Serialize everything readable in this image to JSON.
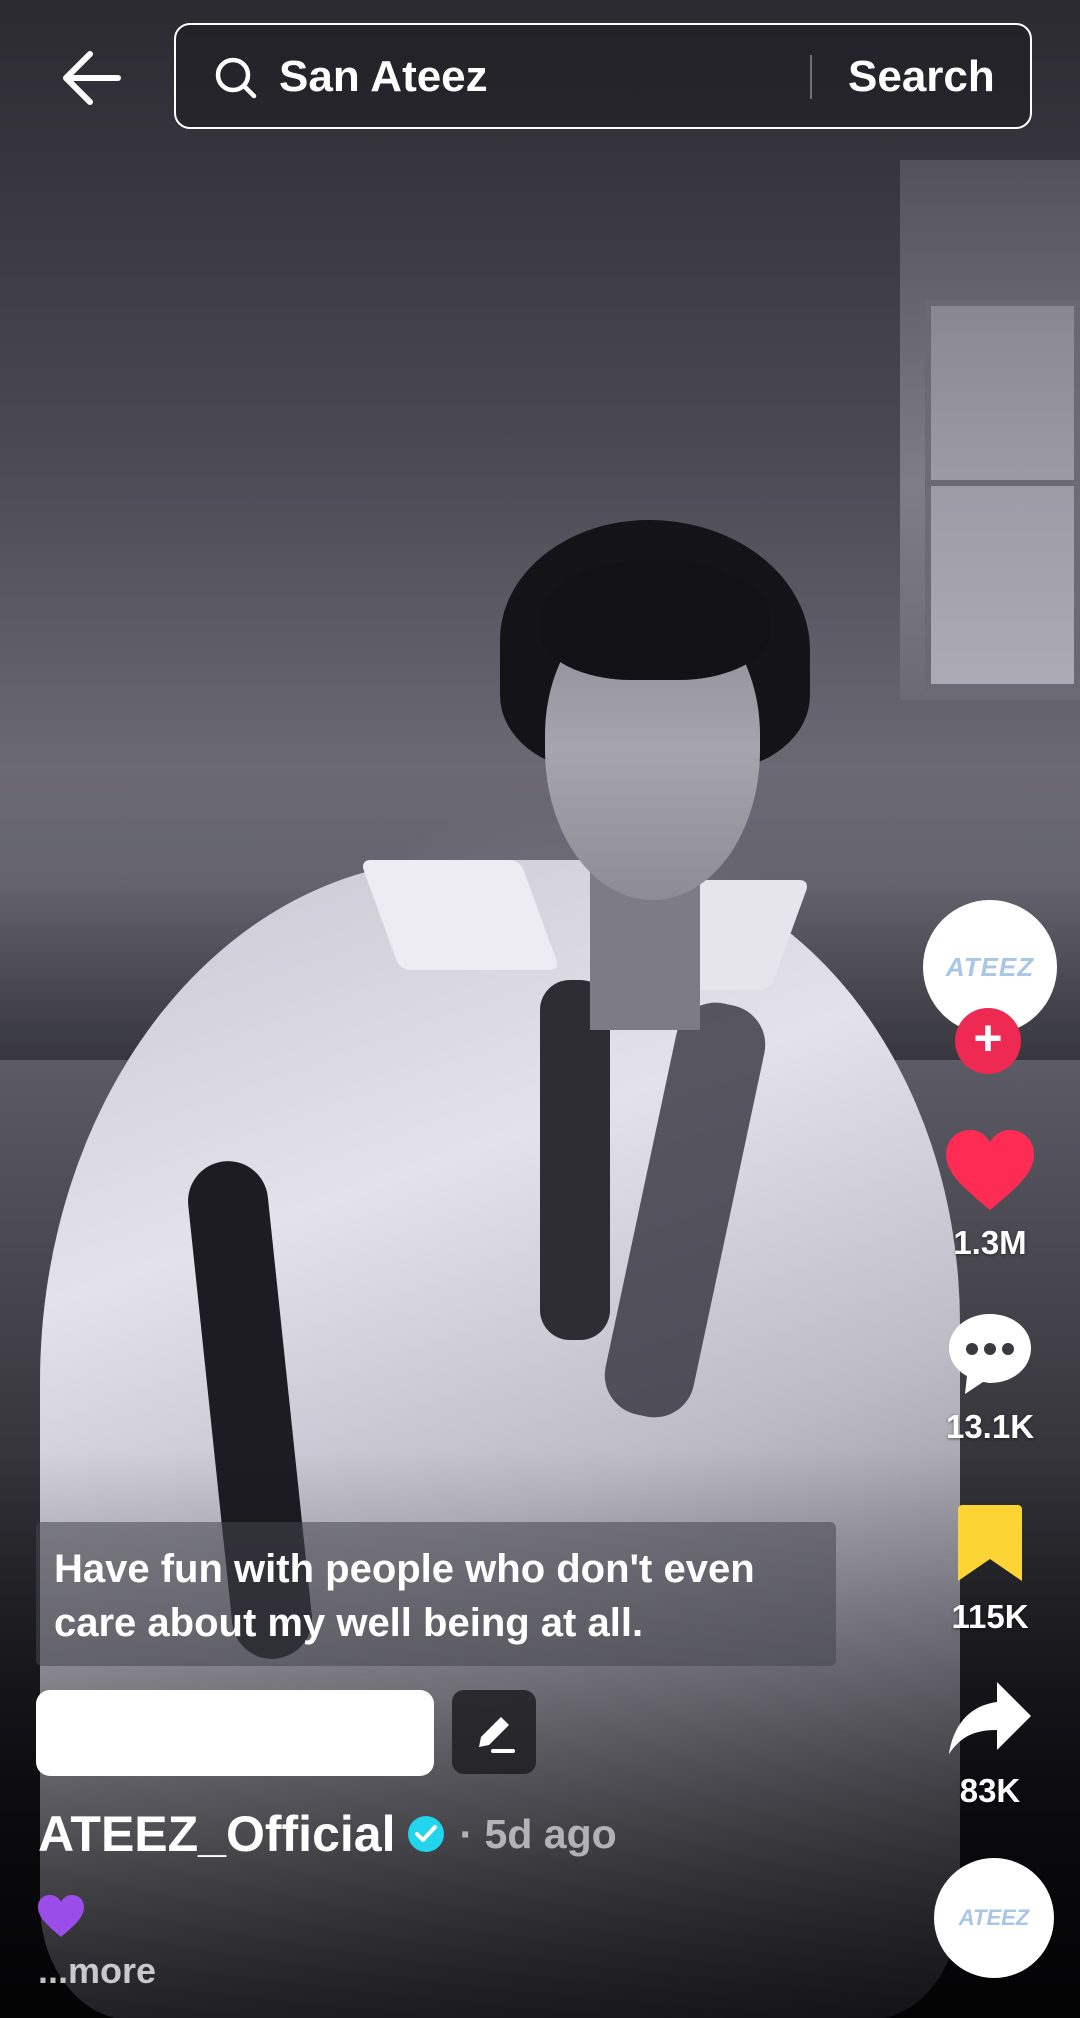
{
  "search": {
    "query": "San Ateez",
    "button_label": "Search"
  },
  "creator": {
    "avatar_logo": "ATEEZ",
    "follow_symbol": "+",
    "name": "ATEEZ_Official",
    "verified": true,
    "posted": "· 5d ago"
  },
  "actions": {
    "likes": "1.3M",
    "comments": "13.1K",
    "saves": "115K",
    "shares": "83K"
  },
  "video": {
    "overlay_text": "Have fun with people who don't even care about my well being at all."
  },
  "caption": {
    "emoji": "purple-heart",
    "more_label": "...more"
  },
  "sound": {
    "disc_logo": "ATEEZ"
  },
  "colors": {
    "like": "#fe2c55",
    "follow": "#ee2a52",
    "save": "#fcd535",
    "verified": "#20d5ec",
    "caption_heart": "#9b4dea"
  },
  "icons": [
    "back-arrow-icon",
    "search-icon",
    "heart-icon",
    "comment-icon",
    "bookmark-icon",
    "share-icon",
    "edit-pencil-icon",
    "verified-badge-icon",
    "purple-heart-icon"
  ]
}
